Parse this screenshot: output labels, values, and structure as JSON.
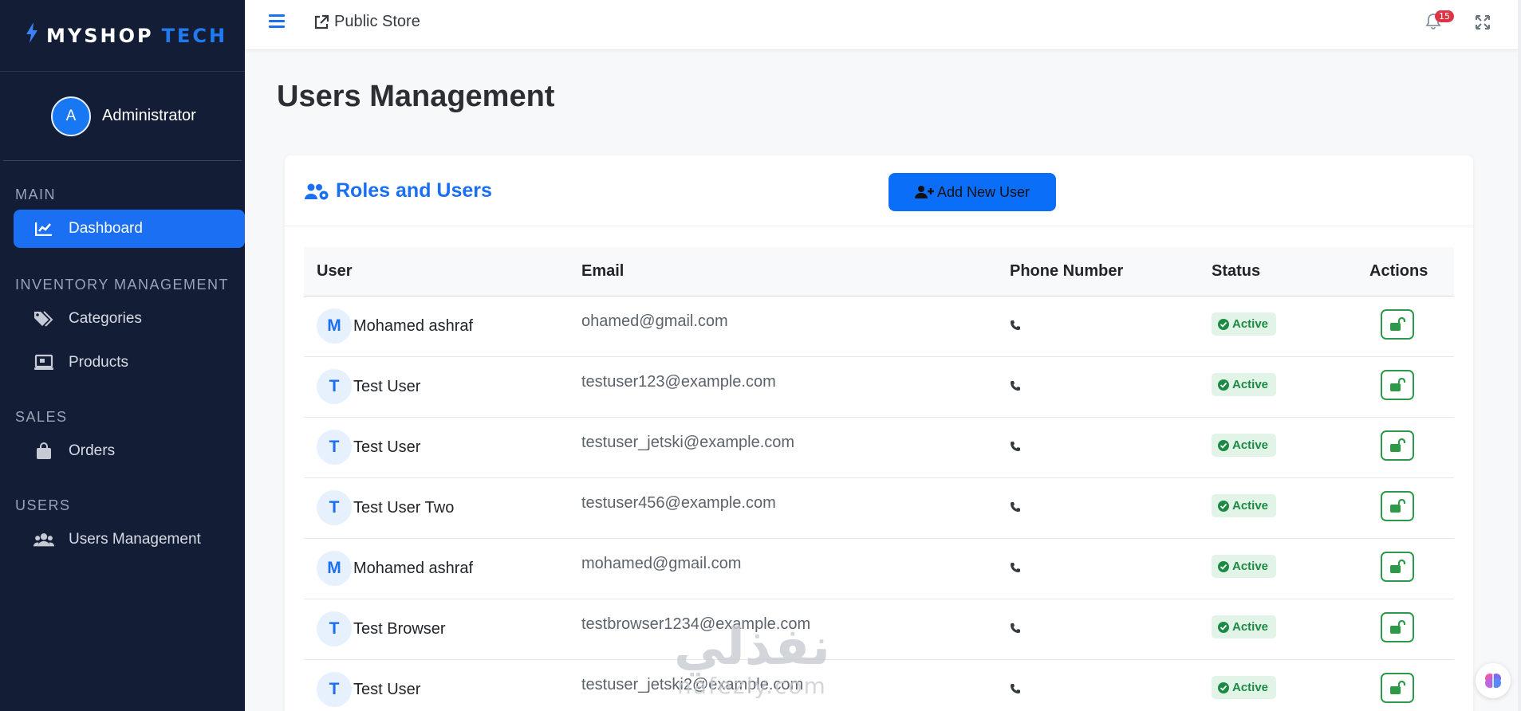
{
  "brand": {
    "part1": "MYSHOP",
    "part2": "TECH"
  },
  "sidebar": {
    "user_initial": "A",
    "user_name": "Administrator",
    "sections": [
      {
        "title": "MAIN",
        "items": [
          {
            "label": "Dashboard",
            "icon": "chart-line-icon",
            "active": true
          }
        ]
      },
      {
        "title": "INVENTORY MANAGEMENT",
        "items": [
          {
            "label": "Categories",
            "icon": "tags-icon"
          },
          {
            "label": "Products",
            "icon": "laptop-icon"
          }
        ]
      },
      {
        "title": "SALES",
        "items": [
          {
            "label": "Orders",
            "icon": "shopping-bag-icon"
          }
        ]
      },
      {
        "title": "USERS",
        "items": [
          {
            "label": "Users Management",
            "icon": "users-icon"
          }
        ]
      }
    ]
  },
  "topbar": {
    "store_link": "Public Store",
    "notification_count": "15"
  },
  "page": {
    "title": "Users Management"
  },
  "card": {
    "title": "Roles and Users",
    "add_button": "Add New User"
  },
  "table": {
    "headers": [
      "User",
      "Email",
      "Phone Number",
      "Status",
      "Actions"
    ],
    "rows": [
      {
        "initial": "M",
        "name": "Mohamed ashraf",
        "email": "ohamed@gmail.com",
        "status": "Active"
      },
      {
        "initial": "T",
        "name": "Test User",
        "email": "testuser123@example.com",
        "status": "Active"
      },
      {
        "initial": "T",
        "name": "Test User",
        "email": "testuser_jetski@example.com",
        "status": "Active"
      },
      {
        "initial": "T",
        "name": "Test User Two",
        "email": "testuser456@example.com",
        "status": "Active"
      },
      {
        "initial": "M",
        "name": "Mohamed ashraf",
        "email": "mohamed@gmail.com",
        "status": "Active"
      },
      {
        "initial": "T",
        "name": "Test Browser",
        "email": "testbrowser1234@example.com",
        "status": "Active"
      },
      {
        "initial": "T",
        "name": "Test User",
        "email": "testuser_jetski2@example.com",
        "status": "Active"
      }
    ]
  },
  "watermark": {
    "arabic": "نفذلي",
    "latin": "nafezly.com"
  },
  "colors": {
    "sidebar_bg": "#131d36",
    "accent": "#1a6ff2",
    "success": "#1c8a43"
  }
}
